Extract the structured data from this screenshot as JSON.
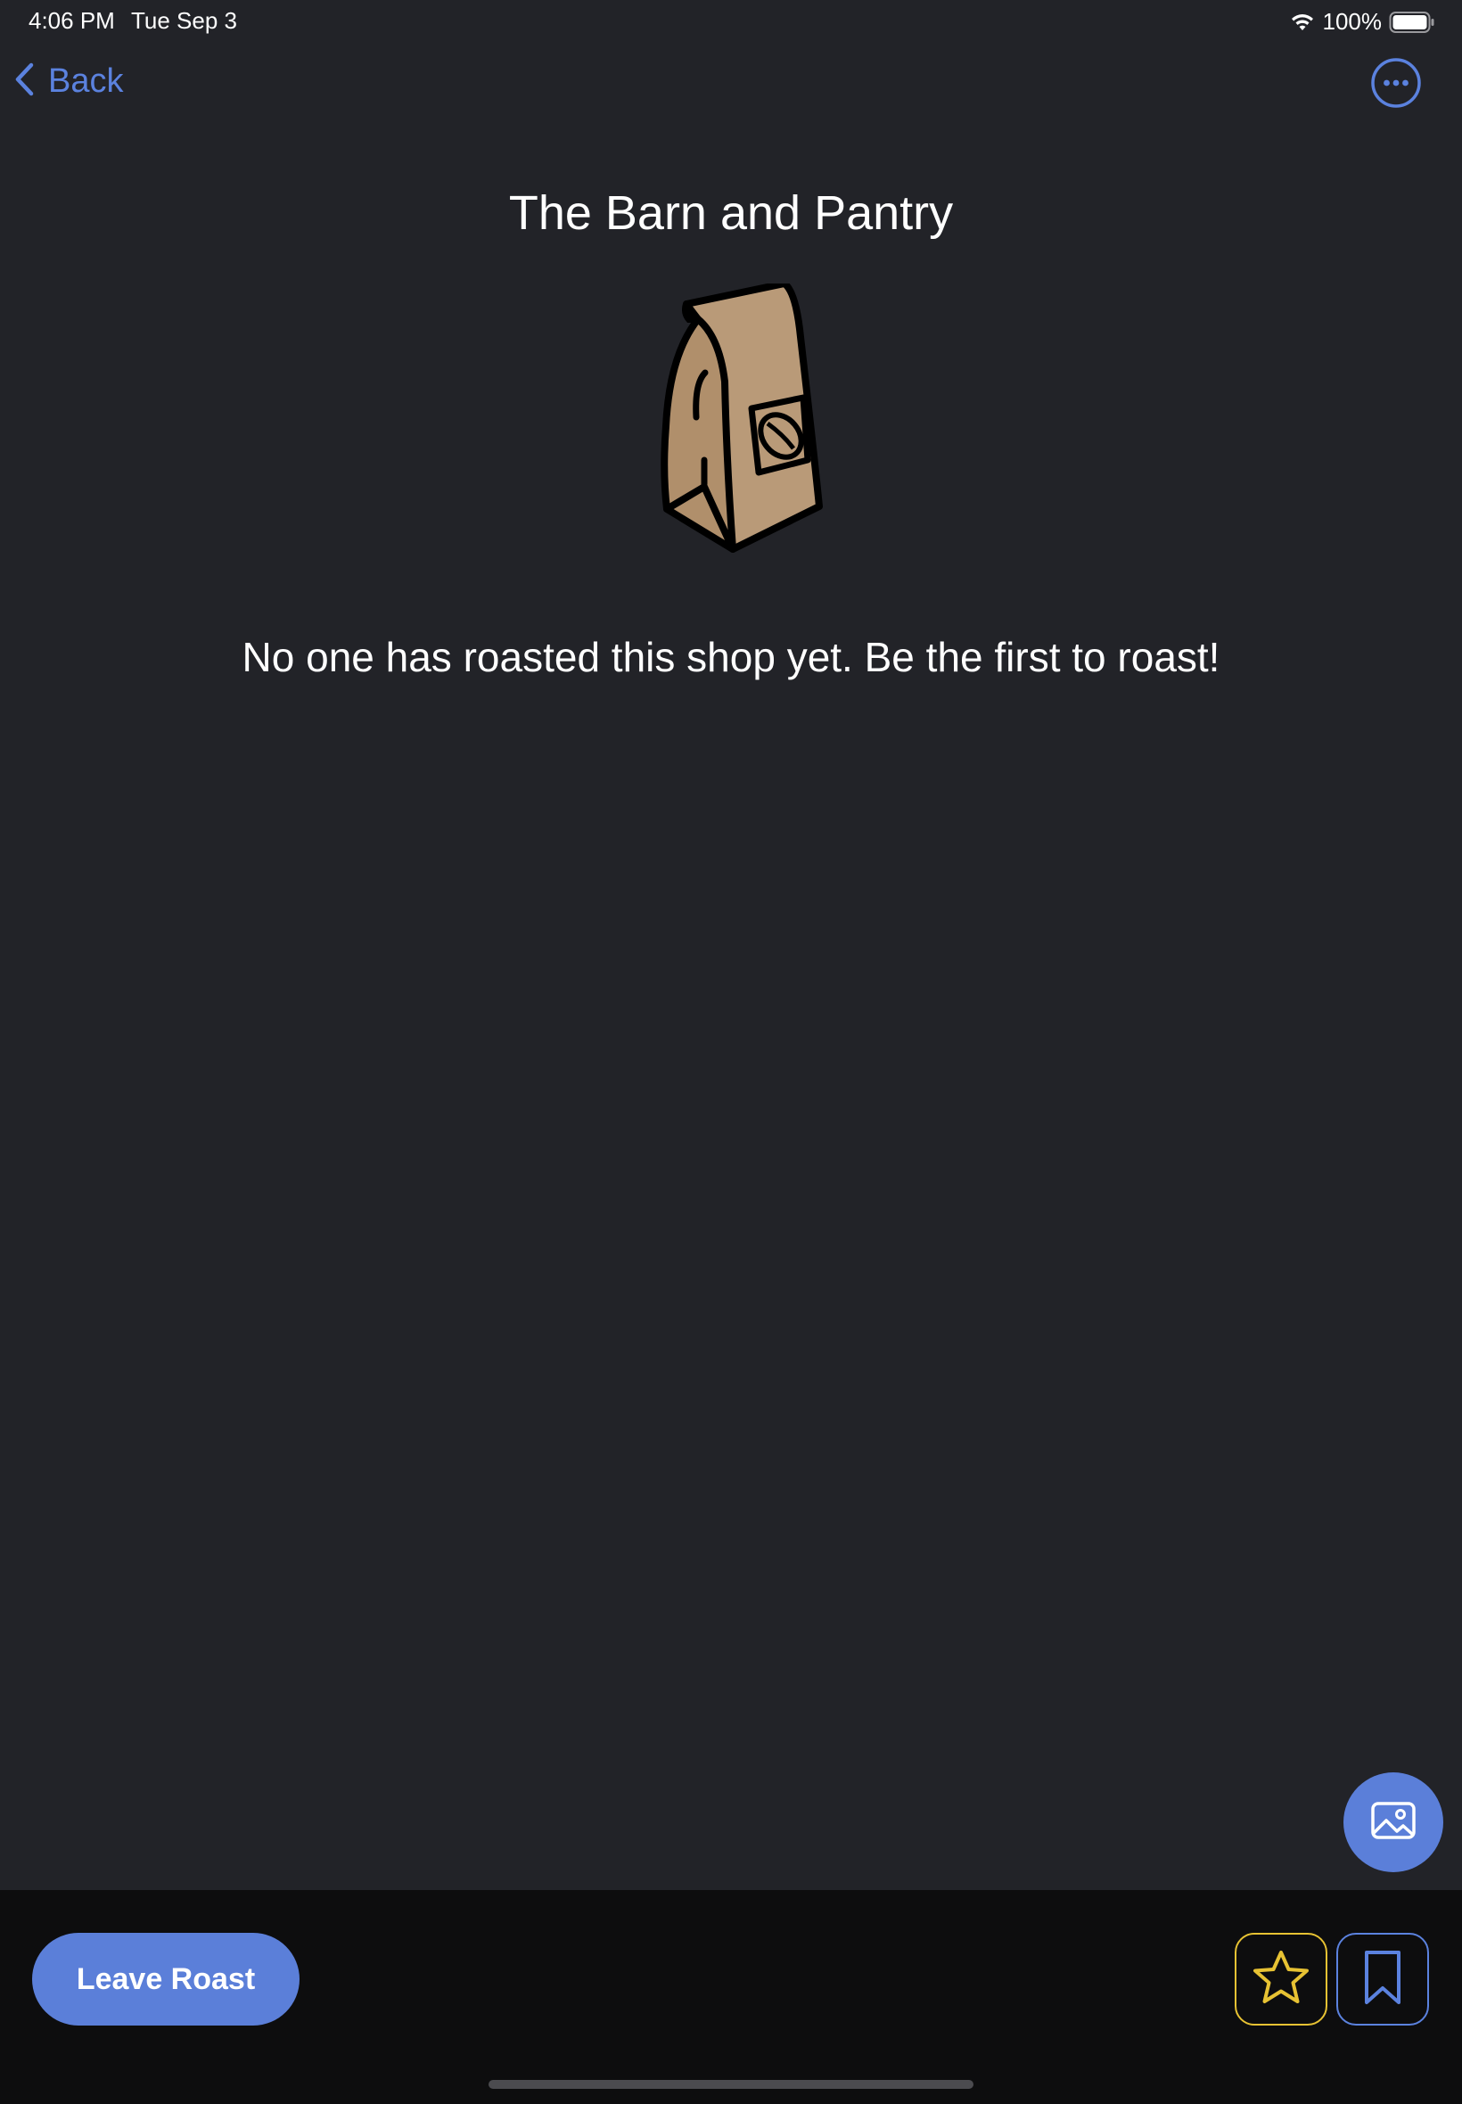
{
  "status_bar": {
    "time": "4:06 PM",
    "date": "Tue Sep 3",
    "battery": "100%",
    "icons": [
      "wifi-icon",
      "battery-icon"
    ]
  },
  "nav": {
    "back_label": "Back",
    "back_icon": "chevron-left-icon",
    "more_icon": "ellipsis-circle-icon"
  },
  "shop": {
    "name": "The Barn and Pantry",
    "illustration": "coffee-bag-icon"
  },
  "empty_state": {
    "message": "No one has roasted this shop yet. Be the first to roast!"
  },
  "fab": {
    "icon": "photo-icon"
  },
  "bottom_bar": {
    "leave_roast_label": "Leave Roast",
    "favorite_icon": "star-icon",
    "bookmark_icon": "bookmark-icon"
  },
  "colors": {
    "background": "#222328",
    "accent": "#5b7fd9",
    "star": "#e7c233",
    "bottom_bar": "#0d0d0e",
    "bag_fill": "#b99a78"
  }
}
